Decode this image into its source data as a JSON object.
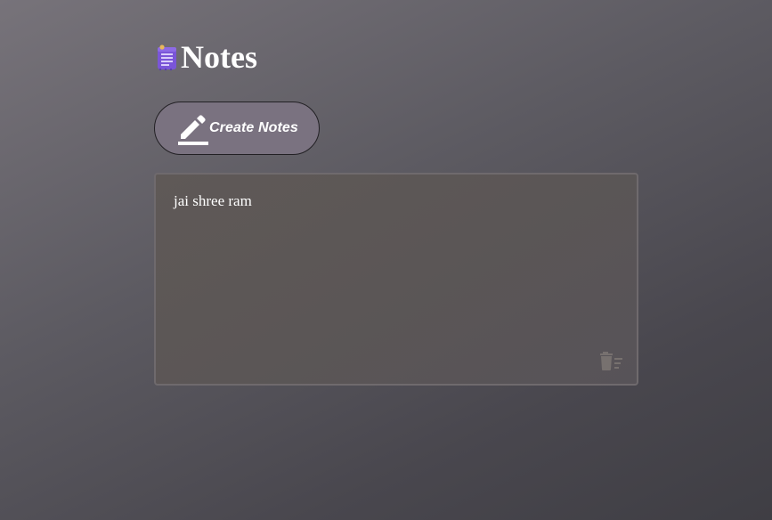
{
  "header": {
    "logo_icon": "notepad-icon",
    "title": "Notes"
  },
  "toolbar": {
    "create_icon": "pencil-icon",
    "create_label": "Create Notes"
  },
  "notes": [
    {
      "text": "jai shree ram",
      "delete_icon": "delete-sweep-icon"
    }
  ],
  "colors": {
    "button_background": "#7a7280",
    "card_background": "#5b5656",
    "logo_purple": "#7a55d8",
    "text": "#ffffff"
  }
}
